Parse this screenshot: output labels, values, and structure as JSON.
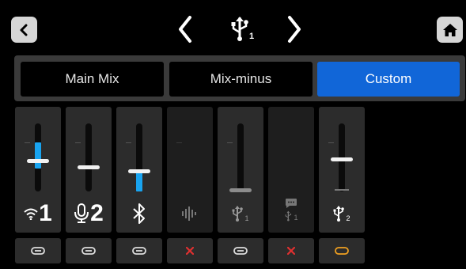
{
  "header": {
    "back": {
      "icon": "chevron-left-icon"
    },
    "prev": {
      "icon": "chevron-left-icon"
    },
    "next": {
      "icon": "chevron-right-icon"
    },
    "current_source": {
      "icon": "usb-icon",
      "label": "1"
    },
    "home": {
      "icon": "home-icon"
    }
  },
  "tabs": [
    {
      "label": "Main Mix",
      "selected": false
    },
    {
      "label": "Mix-minus",
      "selected": false
    },
    {
      "label": "Custom",
      "selected": true
    }
  ],
  "colors": {
    "accent": "#1166d8",
    "meter": "#19a4f0",
    "mute": "#e03030",
    "link_alt": "#f0a020"
  },
  "channels": [
    {
      "icon": "wifi-icon",
      "label": "1",
      "level": 0.7,
      "meter": 0.38,
      "active": true,
      "button_icon": "link-icon"
    },
    {
      "icon": "microphone-icon",
      "label": "2",
      "level": 0.62,
      "meter": 0,
      "active": true,
      "button_icon": "link-icon"
    },
    {
      "icon": "bluetooth-icon",
      "label": "",
      "level": 0.31,
      "meter": 0.29,
      "active": true,
      "button_icon": "link-icon"
    },
    {
      "icon": "audio-wave-icon",
      "label": "",
      "level": null,
      "meter": 0,
      "active": false,
      "button_icon": "x-icon"
    },
    {
      "icon": "usb-icon",
      "label": "1",
      "level": 0.04,
      "meter": 0,
      "active": true,
      "button_icon": "link-icon"
    },
    {
      "icon": "chat-usb-icon",
      "label": "1",
      "level": null,
      "meter": 0,
      "active": false,
      "button_icon": "x-icon"
    },
    {
      "icon": "usb-icon",
      "label": "2",
      "level": 0.77,
      "meter": 0,
      "active": true,
      "button_icon": "link-broken-icon"
    }
  ]
}
